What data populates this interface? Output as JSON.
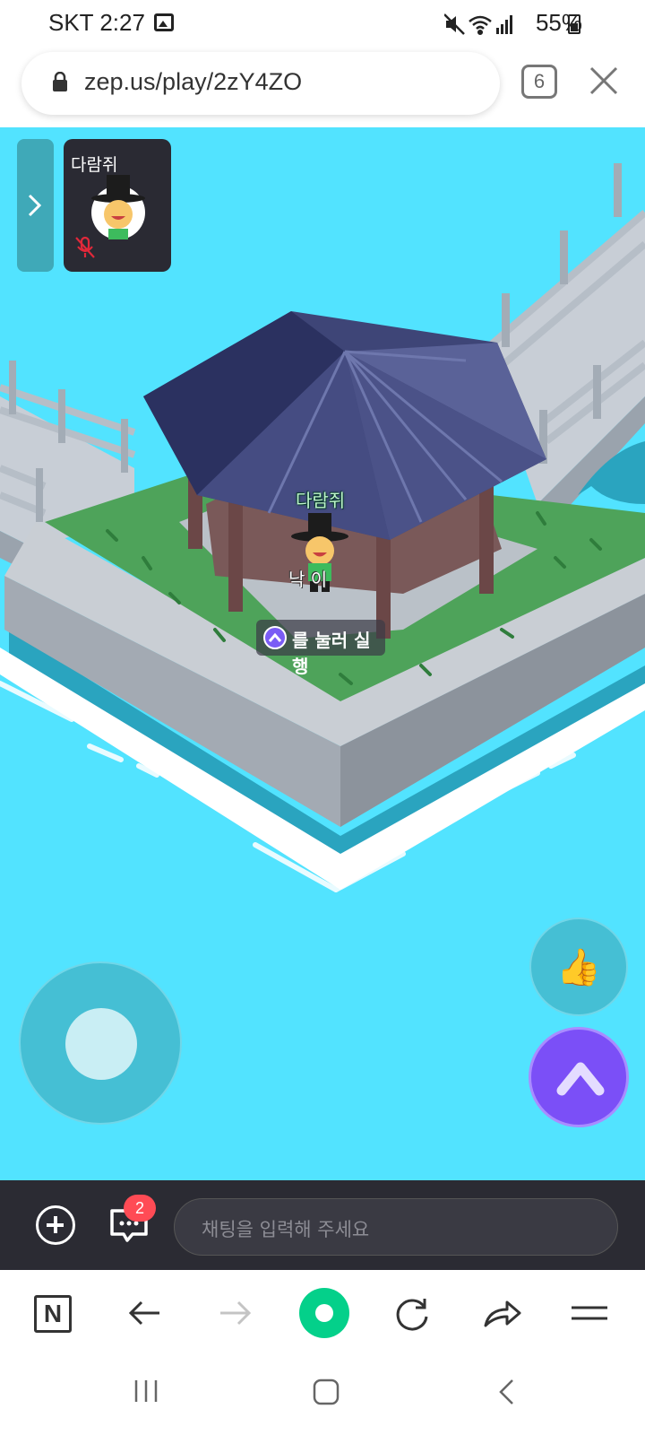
{
  "status_bar": {
    "carrier_time": "SKT 2:27",
    "battery_percent": "55%",
    "icons": [
      "gallery-notification-icon",
      "mute-icon",
      "wifi-icon",
      "signal-icon",
      "battery-icon"
    ]
  },
  "browser": {
    "url": "zep.us/play/2zY4ZO",
    "tab_count": "6"
  },
  "game": {
    "player_card_name": "다람쥐",
    "player_nametag": "다람쥐",
    "npc_label": "낙 이",
    "action_hint": "를 눌러 실행",
    "like_emoji": "👍"
  },
  "chat": {
    "unread_count": "2",
    "placeholder": "채팅을 입력해 주세요"
  },
  "toolbar": {
    "home_label": "N"
  },
  "colors": {
    "water": "#52e3ff",
    "chat_bar": "#2b2b33",
    "accent_purple": "#7b4ff7",
    "badge_red": "#ff4b55",
    "naver_green": "#04d08a"
  }
}
